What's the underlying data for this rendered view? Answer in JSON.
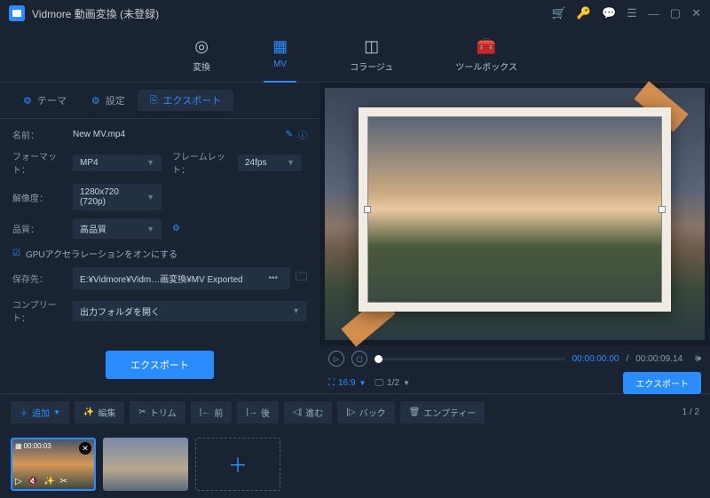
{
  "app": {
    "title": "Vidmore 動画変換 (未登録)"
  },
  "nav": {
    "convert": "変換",
    "mv": "MV",
    "collage": "コラージュ",
    "toolbox": "ツールボックス"
  },
  "subtabs": {
    "theme": "テーマ",
    "settings": "設定",
    "export": "エクスポート"
  },
  "form": {
    "name_label": "名前：",
    "name_value": "New MV.mp4",
    "format_label": "フォーマット：",
    "format_value": "MP4",
    "framerate_label": "フレームレット：",
    "framerate_value": "24fps",
    "resolution_label": "解像度：",
    "resolution_value": "1280x720 (720p)",
    "quality_label": "品質：",
    "quality_value": "高品質",
    "gpu_label": "GPUアクセラレーションをオンにする",
    "saveto_label": "保存先：",
    "saveto_value": "E:¥Vidmore¥Vidm…画変換¥MV Exported",
    "complete_label": "コンプリート：",
    "complete_value": "出力フォルダを開く",
    "export_btn": "エクスポート"
  },
  "player": {
    "cur_time": "00:00:00.00",
    "total_time": "00:00:09.14",
    "aspect": "16:9",
    "page": "1/2",
    "export": "エクスポート"
  },
  "toolbar": {
    "add": "追加",
    "edit": "編集",
    "trim": "トリム",
    "before": "前",
    "after": "後",
    "forward": "進む",
    "back": "バック",
    "empty": "エンプティー",
    "page": "1 / 2"
  },
  "clip": {
    "time": "00:00:03"
  }
}
